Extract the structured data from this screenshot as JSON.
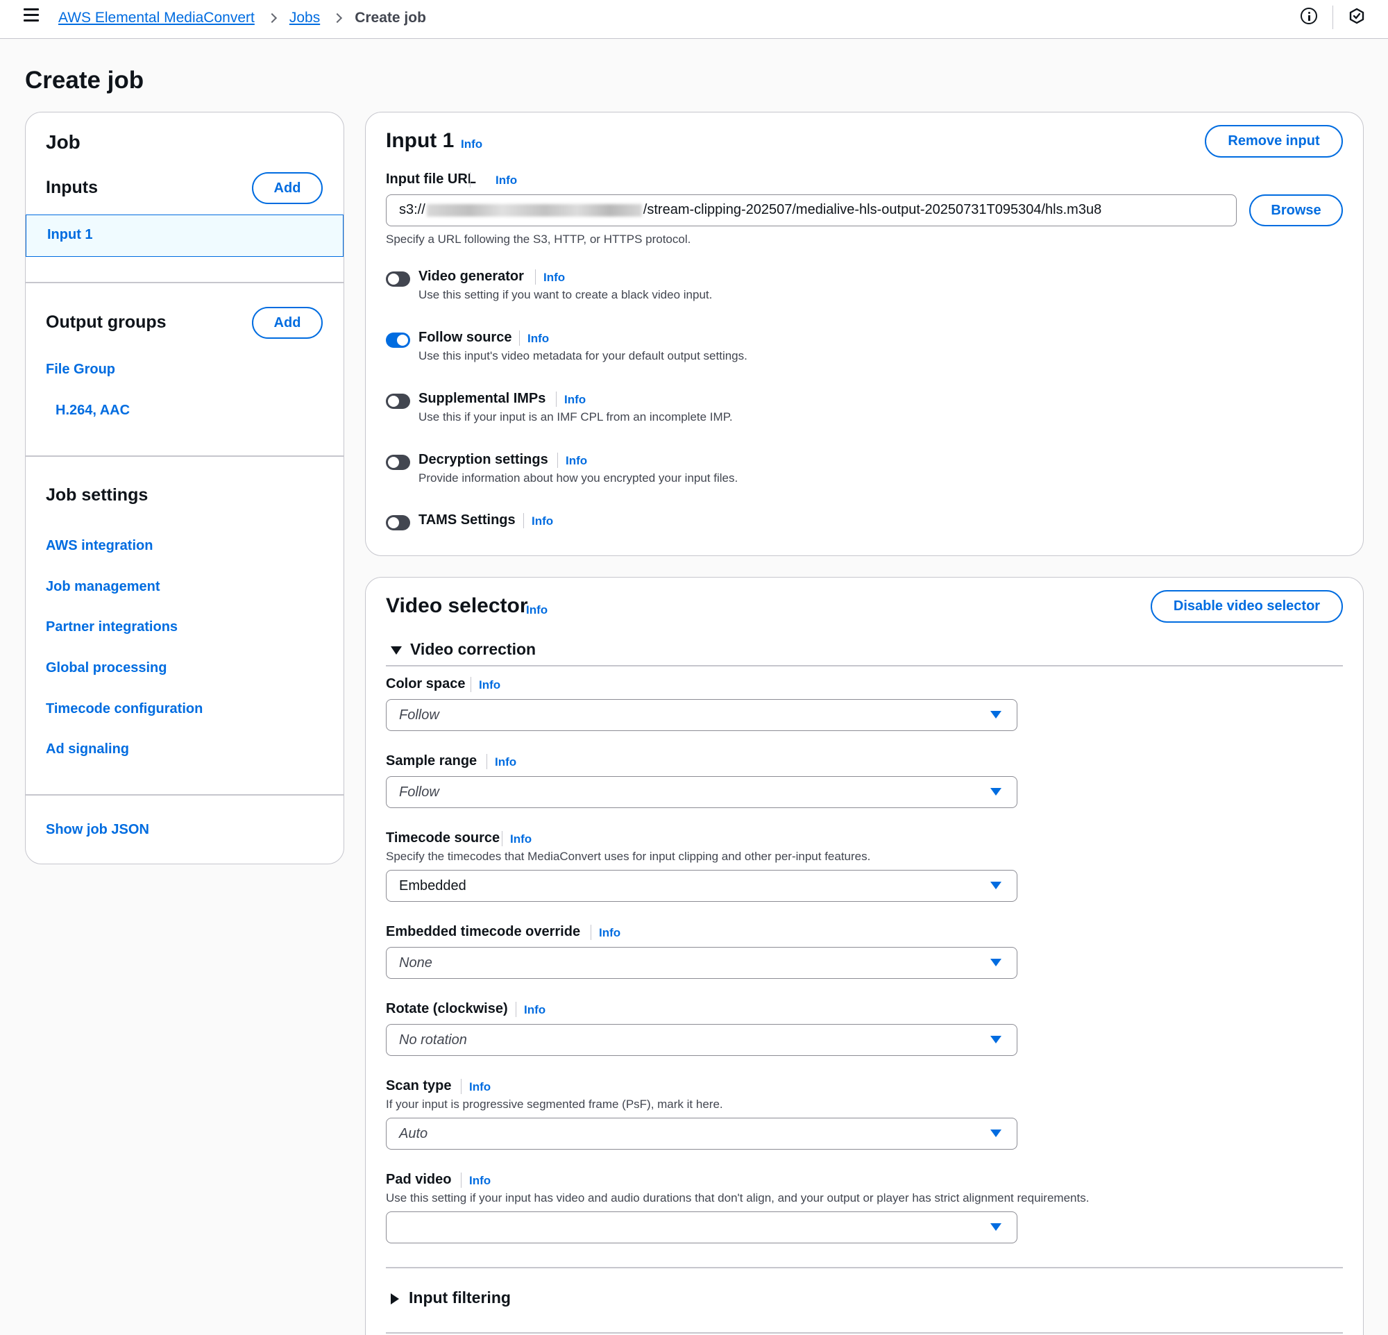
{
  "breadcrumb": {
    "service": "AWS Elemental MediaConvert",
    "jobs": "Jobs",
    "current": "Create job"
  },
  "page": {
    "title": "Create job"
  },
  "nav": {
    "job_heading": "Job",
    "inputs_heading": "Inputs",
    "add_label": "Add",
    "input_item": "Input 1",
    "output_groups_heading": "Output groups",
    "output_group_item": "File Group",
    "output_sub_item": "H.264, AAC",
    "job_settings_heading": "Job settings",
    "job_settings_items": [
      "AWS integration",
      "Job management",
      "Partner integrations",
      "Global processing",
      "Timecode configuration",
      "Ad signaling"
    ],
    "show_json": "Show job JSON"
  },
  "input": {
    "title": "Input 1",
    "info": "Info",
    "remove_label": "Remove input",
    "url_label": "Input file URL",
    "url_prefix": "s3://",
    "url_suffix": "/stream-clipping-202507/medialive-hls-output-20250731T095304/hls.m3u8",
    "browse_label": "Browse",
    "url_hint": "Specify a URL following the S3, HTTP, or HTTPS protocol.",
    "toggles": [
      {
        "label": "Video generator",
        "desc": "Use this setting if you want to create a black video input.",
        "on": false
      },
      {
        "label": "Follow source",
        "desc": "Use this input's video metadata for your default output settings.",
        "on": true
      },
      {
        "label": "Supplemental IMPs",
        "desc": "Use this if your input is an IMF CPL from an incomplete IMP.",
        "on": false
      },
      {
        "label": "Decryption settings",
        "desc": "Provide information about how you encrypted your input files.",
        "on": false
      },
      {
        "label": "TAMS Settings",
        "desc": "",
        "on": false
      }
    ]
  },
  "video_selector": {
    "title": "Video selector",
    "disable_label": "Disable video selector",
    "correction_heading": "Video correction",
    "fields": [
      {
        "label": "Color space",
        "desc": "",
        "value": "Follow",
        "placeholder": true
      },
      {
        "label": "Sample range",
        "desc": "",
        "value": "Follow",
        "placeholder": true
      },
      {
        "label": "Timecode source",
        "desc": "Specify the timecodes that MediaConvert uses for input clipping and other per-input features.",
        "value": "Embedded",
        "placeholder": false
      },
      {
        "label": "Embedded timecode override",
        "desc": "",
        "value": "None",
        "placeholder": true
      },
      {
        "label": "Rotate (clockwise)",
        "desc": "",
        "value": "No rotation",
        "placeholder": true
      },
      {
        "label": "Scan type",
        "desc": "If your input is progressive segmented frame (PsF), mark it here.",
        "value": "Auto",
        "placeholder": true
      },
      {
        "label": "Pad video",
        "desc": "Use this setting if your input has video and audio durations that don't align, and your output or player has strict alignment requirements.",
        "value": "",
        "placeholder": false
      }
    ],
    "filtering_heading": "Input filtering"
  },
  "colors": {
    "link": "#006ce0",
    "border": "#c6c6cd",
    "text": "#0f141a",
    "muted": "#424650"
  }
}
